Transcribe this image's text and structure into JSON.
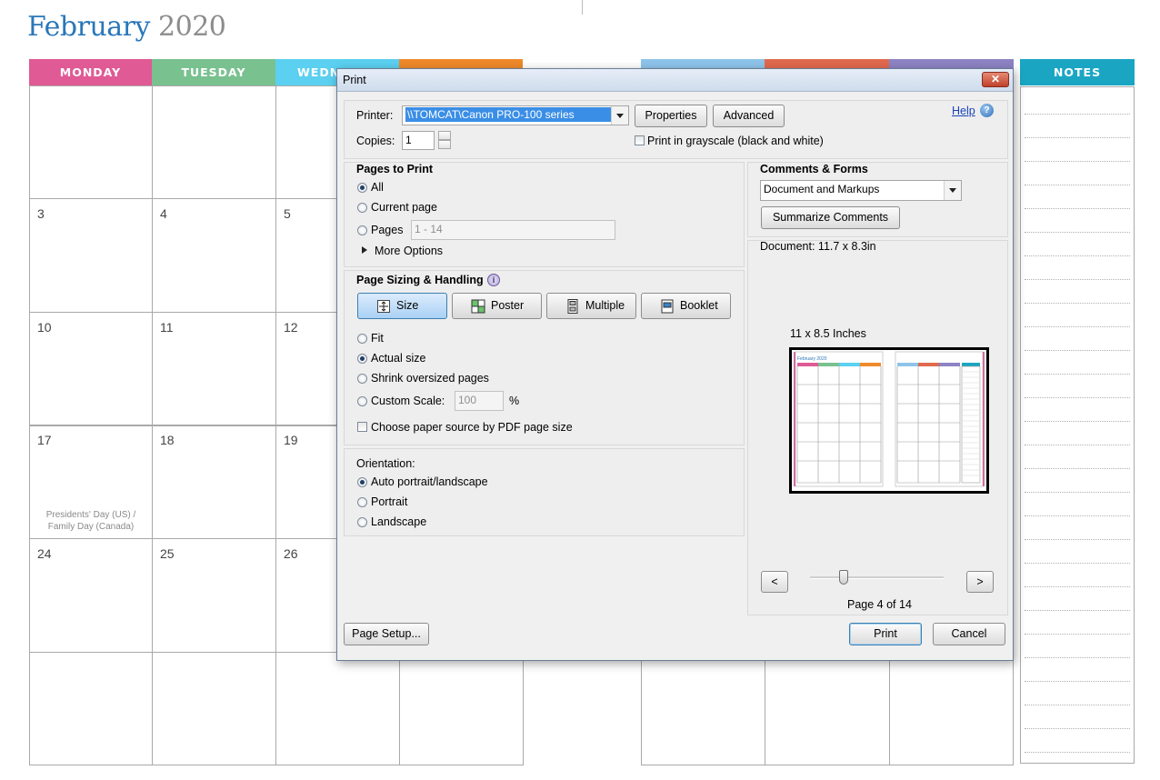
{
  "calendar": {
    "month": "February",
    "year": "2020",
    "day_headers": [
      {
        "label": "MONDAY",
        "color": "#e05a95"
      },
      {
        "label": "TUESDAY",
        "color": "#79c18f"
      },
      {
        "label": "WEDN",
        "color": "#5bd0f0"
      },
      {
        "label": "",
        "color": "#ef8a2b"
      },
      {
        "label": "",
        "color": "#8ec4ea"
      },
      {
        "label": "",
        "color": "#e0694e"
      },
      {
        "label": "",
        "color": "#8d83c4"
      }
    ],
    "notes_header": "NOTES",
    "notes_color": "#1aa6c3",
    "days": {
      "r2c1": "3",
      "r2c2": "4",
      "r2c3": "5",
      "r3c1": "10",
      "r3c2": "11",
      "r3c3": "12",
      "r4c1": "17",
      "r4c2": "18",
      "r4c3": "19",
      "r5c1": "24",
      "r5c2": "25",
      "r5c3": "26"
    },
    "holiday_line1": "Presidents' Day (US) /",
    "holiday_line2": "Family Day (Canada)"
  },
  "dialog": {
    "title": "Print",
    "close_label": "✕",
    "printer_label": "Printer:",
    "printer_value": "\\\\TOMCAT\\Canon PRO-100 series",
    "properties_button": "Properties",
    "advanced_button": "Advanced",
    "help_link": "Help",
    "copies_label": "Copies:",
    "copies_value": "1",
    "grayscale_label": "Print in grayscale (black and white)",
    "grayscale_checked": false,
    "pages_to_print": {
      "heading": "Pages to Print",
      "all": "All",
      "current_page": "Current page",
      "pages": "Pages",
      "pages_range": "1 - 14",
      "more_options": "More Options",
      "selected": "All"
    },
    "page_sizing": {
      "heading": "Page Sizing & Handling",
      "modes": [
        "Size",
        "Poster",
        "Multiple",
        "Booklet"
      ],
      "selected_mode": "Size",
      "fit": "Fit",
      "actual_size": "Actual size",
      "shrink": "Shrink oversized pages",
      "custom_scale": "Custom Scale:",
      "scale_value": "100",
      "percent": "%",
      "paper_source": "Choose paper source by PDF page size",
      "selected": "Actual size"
    },
    "orientation": {
      "heading": "Orientation:",
      "auto": "Auto portrait/landscape",
      "portrait": "Portrait",
      "landscape": "Landscape",
      "selected": "Auto portrait/landscape"
    },
    "comments_forms": {
      "heading": "Comments & Forms",
      "value": "Document and Markups",
      "summarize_button": "Summarize Comments"
    },
    "document_size": "Document: 11.7 x 8.3in",
    "paper_size": "11 x 8.5 Inches",
    "prev_button": "<",
    "next_button": ">",
    "page_indicator": "Page 4 of 14",
    "current_page": 4,
    "total_pages": 14,
    "page_setup_button": "Page Setup...",
    "print_button": "Print",
    "cancel_button": "Cancel"
  }
}
